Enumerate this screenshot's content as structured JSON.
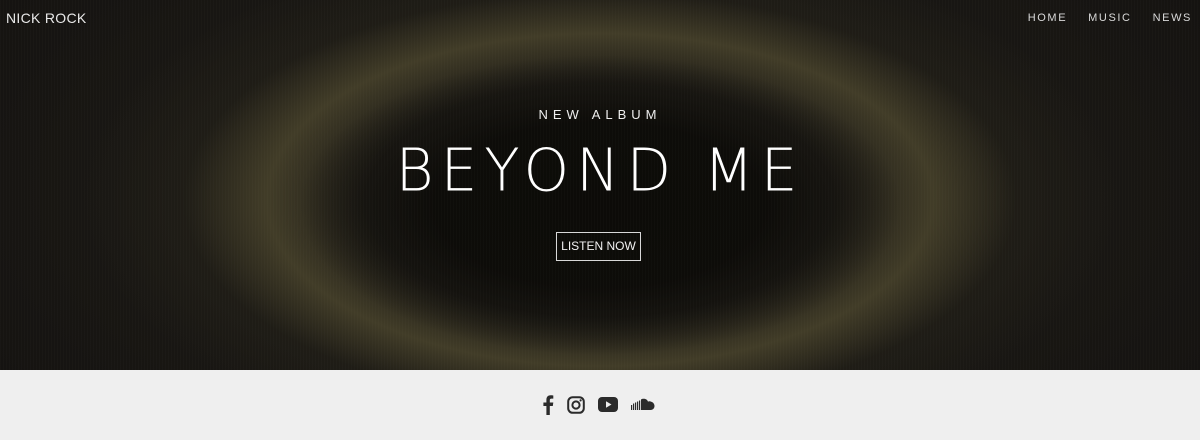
{
  "header": {
    "brand": "NICK ROCK",
    "nav": [
      {
        "label": "HOME"
      },
      {
        "label": "MUSIC"
      },
      {
        "label": "NEWS"
      }
    ]
  },
  "hero": {
    "eyebrow": "NEW ALBUM",
    "title": "BEYOND ME",
    "cta_label": "LISTEN NOW"
  },
  "footer": {
    "social": [
      {
        "icon": "facebook-icon"
      },
      {
        "icon": "instagram-icon"
      },
      {
        "icon": "youtube-icon"
      },
      {
        "icon": "soundcloud-icon"
      }
    ],
    "icon_color": "#2b2b2b",
    "background": "#efefef"
  }
}
